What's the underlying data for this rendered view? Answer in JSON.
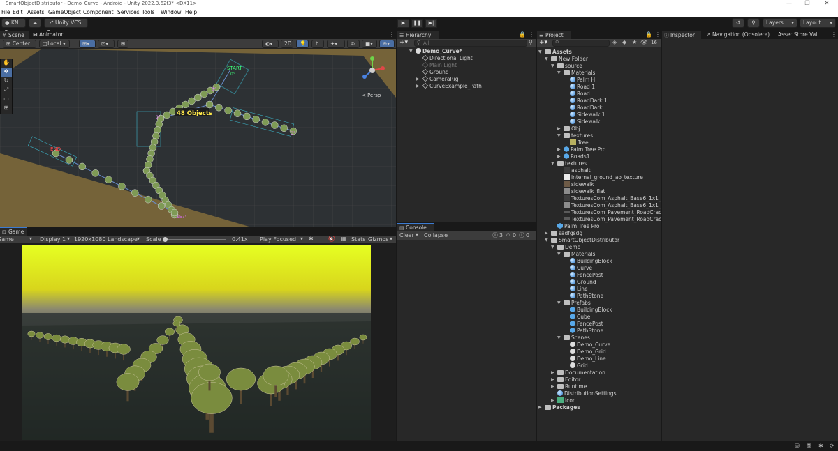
{
  "window": {
    "title": "SmartObjectDistributor - Demo_Curve - Android - Unity 2022.3.62f3* <DX11>",
    "controls": [
      "—",
      "❐",
      "✕"
    ]
  },
  "menu": [
    "File",
    "Edit",
    "Assets",
    "GameObject",
    "Component",
    "Services",
    "Tools",
    "Window",
    "Help"
  ],
  "toolbar": {
    "account": "KN",
    "vcs": "Unity VCS",
    "layers": "Layers",
    "layout": "Layout"
  },
  "scene_panel": {
    "tabs": [
      "Scene",
      "Animator"
    ],
    "pivot": "Center",
    "space": "Local",
    "mode_2d": "2D",
    "persp_label": "< Persp",
    "objects_label": "48 Objects",
    "start_label": "START",
    "end_label": "END",
    "start_angle": "0°",
    "angle_labels": [
      "0°",
      "0°",
      "0°",
      "157°"
    ]
  },
  "game_panel": {
    "tab": "Game",
    "view": "Game",
    "display": "Display 1",
    "resolution": "1920x1080 Landscape",
    "scale_label": "Scale",
    "scale_value": "0.41x",
    "play_mode": "Play Focused",
    "stats": "Stats",
    "gizmos": "Gizmos"
  },
  "hierarchy": {
    "tab": "Hierarchy",
    "search_placeholder": "All",
    "items": [
      {
        "label": "Demo_Curve*",
        "depth": 0,
        "kind": "scene",
        "arrow": "▼"
      },
      {
        "label": "Directional Light",
        "depth": 1,
        "kind": "go",
        "arrow": ""
      },
      {
        "label": "Main Light",
        "depth": 1,
        "kind": "go-off",
        "arrow": ""
      },
      {
        "label": "Ground",
        "depth": 1,
        "kind": "go",
        "arrow": ""
      },
      {
        "label": "CameraRig",
        "depth": 1,
        "kind": "go",
        "arrow": "▶"
      },
      {
        "label": "CurveExample_Path",
        "depth": 1,
        "kind": "go",
        "arrow": "▶"
      }
    ]
  },
  "console": {
    "tab": "Console",
    "clear": "Clear",
    "collapse": "Collapse",
    "counts": [
      "3",
      "0",
      "0"
    ]
  },
  "project": {
    "tab": "Project",
    "count": "16",
    "items": [
      {
        "label": "Assets",
        "depth": 0,
        "kind": "folder",
        "arrow": "▼",
        "bold": true
      },
      {
        "label": "New Folder",
        "depth": 1,
        "kind": "folder",
        "arrow": "▼"
      },
      {
        "label": "source",
        "depth": 2,
        "kind": "folder",
        "arrow": "▼"
      },
      {
        "label": "Materials",
        "depth": 3,
        "kind": "folder",
        "arrow": "▼"
      },
      {
        "label": "Palm H",
        "depth": 4,
        "kind": "mat",
        "arrow": ""
      },
      {
        "label": "Road 1",
        "depth": 4,
        "kind": "mat",
        "arrow": ""
      },
      {
        "label": "Road",
        "depth": 4,
        "kind": "mat",
        "arrow": ""
      },
      {
        "label": "RoadDark 1",
        "depth": 4,
        "kind": "mat",
        "arrow": ""
      },
      {
        "label": "RoadDark",
        "depth": 4,
        "kind": "mat",
        "arrow": ""
      },
      {
        "label": "Sidewalk 1",
        "depth": 4,
        "kind": "mat",
        "arrow": ""
      },
      {
        "label": "Sidewalk",
        "depth": 4,
        "kind": "mat",
        "arrow": ""
      },
      {
        "label": "Obj",
        "depth": 3,
        "kind": "folder",
        "arrow": "▶"
      },
      {
        "label": "textures",
        "depth": 3,
        "kind": "folder",
        "arrow": "▼"
      },
      {
        "label": "Tree",
        "depth": 4,
        "kind": "tex-tree",
        "arrow": ""
      },
      {
        "label": "Palm Tree Pro",
        "depth": 3,
        "kind": "cube",
        "arrow": "▶"
      },
      {
        "label": "Roads1",
        "depth": 3,
        "kind": "cube",
        "arrow": "▶"
      },
      {
        "label": "textures",
        "depth": 2,
        "kind": "folder",
        "arrow": "▼"
      },
      {
        "label": "asphalt",
        "depth": 3,
        "kind": "tex-dark",
        "arrow": ""
      },
      {
        "label": "internal_ground_ao_texture",
        "depth": 3,
        "kind": "tex-white",
        "arrow": ""
      },
      {
        "label": "sidewalk",
        "depth": 3,
        "kind": "tex-brown",
        "arrow": ""
      },
      {
        "label": "sidewalk_flat",
        "depth": 3,
        "kind": "tex-grey",
        "arrow": ""
      },
      {
        "label": "TexturesCom_Asphalt_Base6_1x1_512",
        "depth": 3,
        "kind": "tex-dark",
        "arrow": ""
      },
      {
        "label": "TexturesCom_Asphalt_Base6_1x1_512",
        "depth": 3,
        "kind": "tex-grey",
        "arrow": ""
      },
      {
        "label": "TexturesCom_Pavement_RoadCracks",
        "depth": 3,
        "kind": "tex-line",
        "arrow": ""
      },
      {
        "label": "TexturesCom_Pavement_RoadCracks",
        "depth": 3,
        "kind": "tex-line",
        "arrow": ""
      },
      {
        "label": "Palm Tree Pro",
        "depth": 2,
        "kind": "cube",
        "arrow": ""
      },
      {
        "label": "sadfgsdg",
        "depth": 1,
        "kind": "folder",
        "arrow": "▶"
      },
      {
        "label": "SmartObjectDistributor",
        "depth": 1,
        "kind": "folder",
        "arrow": "▼"
      },
      {
        "label": "Demo",
        "depth": 2,
        "kind": "folder",
        "arrow": "▼"
      },
      {
        "label": "Materials",
        "depth": 3,
        "kind": "folder",
        "arrow": "▼"
      },
      {
        "label": "BuildingBlock",
        "depth": 4,
        "kind": "mat",
        "arrow": ""
      },
      {
        "label": "Curve",
        "depth": 4,
        "kind": "mat",
        "arrow": ""
      },
      {
        "label": "FencePost",
        "depth": 4,
        "kind": "mat",
        "arrow": ""
      },
      {
        "label": "Ground",
        "depth": 4,
        "kind": "mat",
        "arrow": ""
      },
      {
        "label": "Line",
        "depth": 4,
        "kind": "mat",
        "arrow": ""
      },
      {
        "label": "PathStone",
        "depth": 4,
        "kind": "mat",
        "arrow": ""
      },
      {
        "label": "Prefabs",
        "depth": 3,
        "kind": "folder",
        "arrow": "▼"
      },
      {
        "label": "BuildingBlock",
        "depth": 4,
        "kind": "cube",
        "arrow": ""
      },
      {
        "label": "Cube",
        "depth": 4,
        "kind": "cube",
        "arrow": ""
      },
      {
        "label": "FencePost",
        "depth": 4,
        "kind": "cube",
        "arrow": ""
      },
      {
        "label": "PathStone",
        "depth": 4,
        "kind": "cube",
        "arrow": ""
      },
      {
        "label": "Scenes",
        "depth": 3,
        "kind": "folder",
        "arrow": "▼"
      },
      {
        "label": "Demo_Curve",
        "depth": 4,
        "kind": "unity",
        "arrow": ""
      },
      {
        "label": "Demo_Grid",
        "depth": 4,
        "kind": "unity",
        "arrow": ""
      },
      {
        "label": "Demo_Line",
        "depth": 4,
        "kind": "unity",
        "arrow": ""
      },
      {
        "label": "Grid",
        "depth": 4,
        "kind": "unity",
        "arrow": ""
      },
      {
        "label": "Documentation",
        "depth": 2,
        "kind": "folder",
        "arrow": "▶"
      },
      {
        "label": "Editor",
        "depth": 2,
        "kind": "folder",
        "arrow": "▶"
      },
      {
        "label": "Runtime",
        "depth": 2,
        "kind": "folder",
        "arrow": "▶"
      },
      {
        "label": "DistributionSettings",
        "depth": 2,
        "kind": "settings",
        "arrow": ""
      },
      {
        "label": "Icon",
        "depth": 2,
        "kind": "tex-icon",
        "arrow": "▶"
      },
      {
        "label": "Packages",
        "depth": 0,
        "kind": "folder",
        "arrow": "▶",
        "bold": true
      }
    ]
  },
  "inspector": {
    "tabs": [
      "Inspector",
      "Navigation (Obsolete)",
      "Asset Store Val"
    ]
  }
}
